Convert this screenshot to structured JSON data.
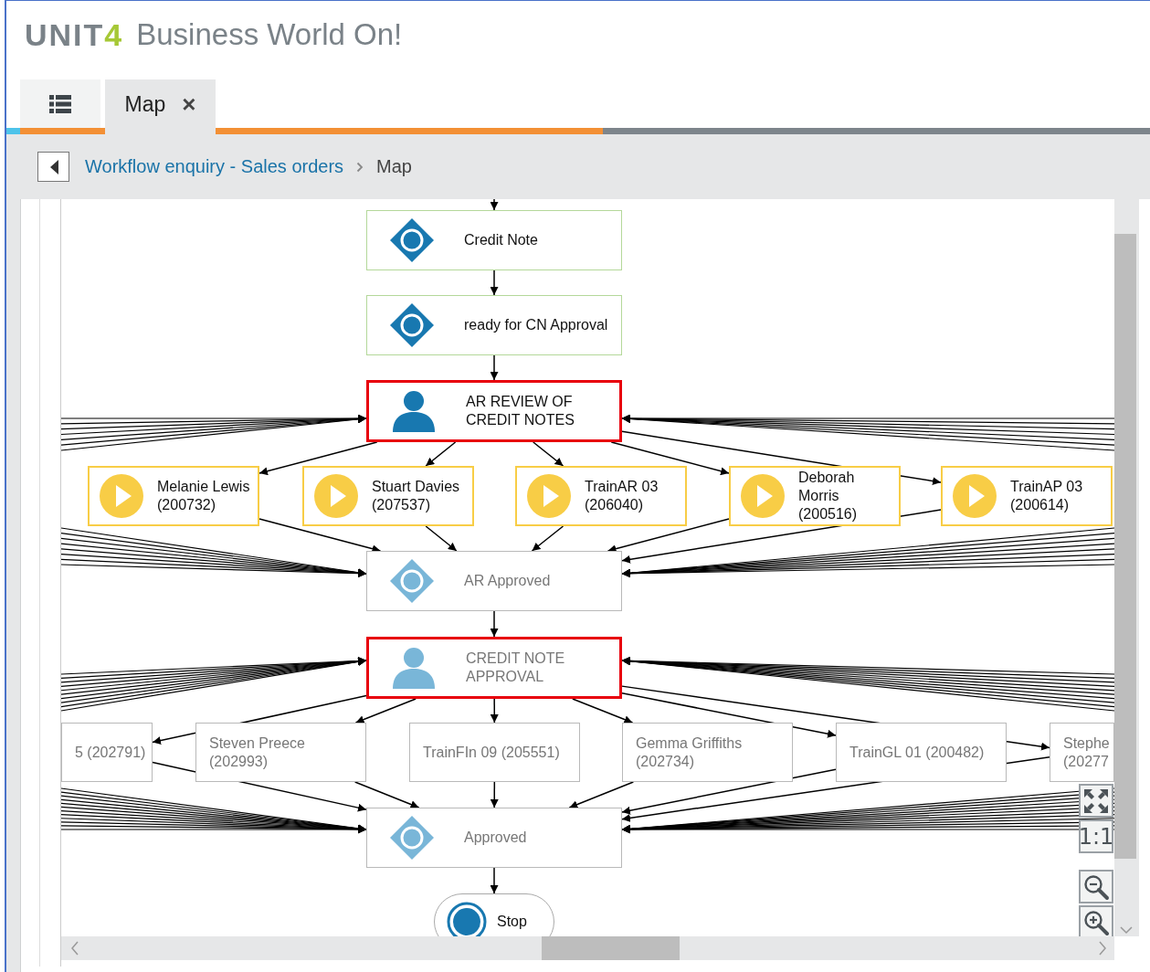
{
  "app": {
    "logo_mark": "UNIT",
    "logo_accent": "4",
    "title": "Business World On!"
  },
  "tabs": [
    {
      "kind": "menu",
      "selected": false
    },
    {
      "kind": "page",
      "label": "Map",
      "close": "×",
      "selected": true
    }
  ],
  "breadcrumb": {
    "links": [
      "Workflow enquiry - Sales orders"
    ],
    "current": "Map"
  },
  "map": {
    "nodes": [
      {
        "kind": "state",
        "lines": [
          "Credit Note"
        ],
        "active": true,
        "highlighted": false
      },
      {
        "kind": "state",
        "lines": [
          "ready for CN Approval"
        ],
        "active": true,
        "highlighted": false
      },
      {
        "kind": "user",
        "lines": [
          "AR REVIEW OF",
          "CREDIT NOTES"
        ],
        "active": true,
        "highlighted": true
      },
      {
        "kind": "task",
        "lines": [
          "Melanie Lewis",
          "(200732)"
        ],
        "active": true,
        "highlighted": false
      },
      {
        "kind": "task",
        "lines": [
          "Stuart Davies",
          "(207537)"
        ],
        "active": true,
        "highlighted": false
      },
      {
        "kind": "task",
        "lines": [
          "TrainAR 03",
          "(206040)"
        ],
        "active": true,
        "highlighted": false
      },
      {
        "kind": "task",
        "lines": [
          "Deborah",
          "Morris",
          "(200516)"
        ],
        "active": true,
        "highlighted": false
      },
      {
        "kind": "task",
        "lines": [
          "TrainAP 03",
          "(200614)"
        ],
        "active": true,
        "highlighted": false
      },
      {
        "kind": "state",
        "lines": [
          "AR Approved"
        ],
        "active": false,
        "highlighted": false
      },
      {
        "kind": "user",
        "lines": [
          "CREDIT NOTE",
          "APPROVAL"
        ],
        "active": false,
        "highlighted": true
      },
      {
        "kind": "plain",
        "lines": [
          "5 (202791)"
        ],
        "active": false,
        "highlighted": false
      },
      {
        "kind": "plain",
        "lines": [
          "Steven Preece",
          "(202993)"
        ],
        "active": false,
        "highlighted": false
      },
      {
        "kind": "plain",
        "lines": [
          "TrainFIn 09 (205551)"
        ],
        "active": false,
        "highlighted": false
      },
      {
        "kind": "plain",
        "lines": [
          "Gemma Griffiths",
          "(202734)"
        ],
        "active": false,
        "highlighted": false
      },
      {
        "kind": "plain",
        "lines": [
          "TrainGL 01 (200482)"
        ],
        "active": false,
        "highlighted": false
      },
      {
        "kind": "plain",
        "lines": [
          "Stephe",
          "(20277"
        ],
        "active": false,
        "highlighted": false
      },
      {
        "kind": "state",
        "lines": [
          "Approved"
        ],
        "active": false,
        "highlighted": false
      },
      {
        "kind": "stop",
        "lines": [
          "Stop"
        ],
        "active": true,
        "highlighted": false
      }
    ],
    "controls": [
      {
        "kind": "fit"
      },
      {
        "kind": "actual-size",
        "label": "1:1"
      },
      {
        "kind": "zoom-out"
      },
      {
        "kind": "zoom-in"
      }
    ]
  }
}
